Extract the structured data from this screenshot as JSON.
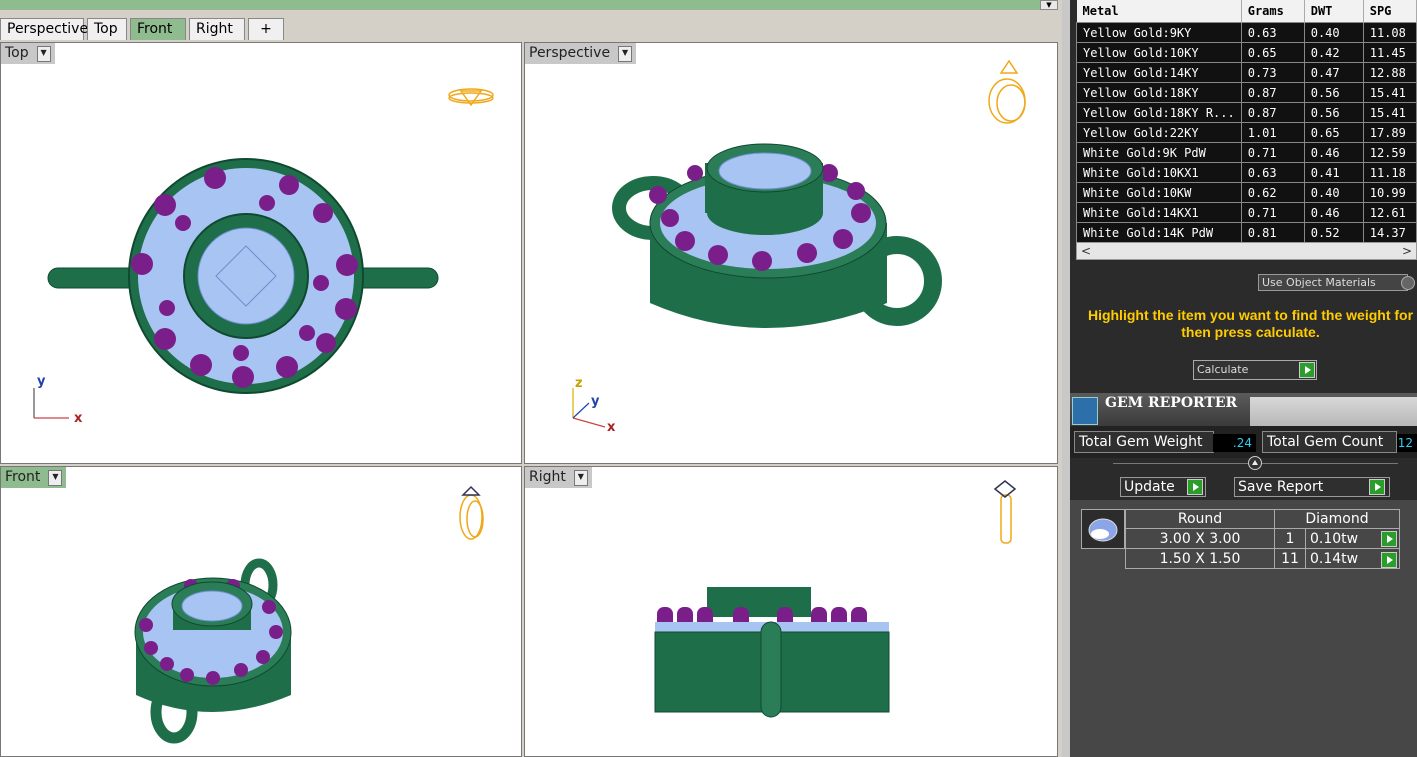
{
  "viewport_tabs": [
    {
      "label": "Perspective",
      "active": false
    },
    {
      "label": "Top",
      "active": false
    },
    {
      "label": "Front",
      "active": true
    },
    {
      "label": "Right",
      "active": false
    },
    {
      "label": "+",
      "active": false
    }
  ],
  "viewports": {
    "top": {
      "label": "Top",
      "axis_x": "x",
      "axis_y": "y"
    },
    "perspective": {
      "label": "Perspective",
      "axis_x": "x",
      "axis_y": "y",
      "axis_z": "z"
    },
    "front": {
      "label": "Front"
    },
    "right": {
      "label": "Right"
    }
  },
  "metal_table": {
    "headers": [
      "Metal",
      "Grams",
      "DWT",
      "SPG"
    ],
    "rows": [
      [
        "Yellow Gold:9KY",
        "0.63",
        "0.40",
        "11.08"
      ],
      [
        "Yellow Gold:10KY",
        "0.65",
        "0.42",
        "11.45"
      ],
      [
        "Yellow Gold:14KY",
        "0.73",
        "0.47",
        "12.88"
      ],
      [
        "Yellow Gold:18KY",
        "0.87",
        "0.56",
        "15.41"
      ],
      [
        "Yellow Gold:18KY R...",
        "0.87",
        "0.56",
        "15.41"
      ],
      [
        "Yellow Gold:22KY",
        "1.01",
        "0.65",
        "17.89"
      ],
      [
        "White Gold:9K PdW",
        "0.71",
        "0.46",
        "12.59"
      ],
      [
        "White Gold:10KX1",
        "0.63",
        "0.41",
        "11.18"
      ],
      [
        "White Gold:10KW",
        "0.62",
        "0.40",
        "10.99"
      ],
      [
        "White Gold:14KX1",
        "0.71",
        "0.46",
        "12.61"
      ],
      [
        "White Gold:14K PdW",
        "0.81",
        "0.52",
        "14.37"
      ]
    ]
  },
  "use_object_materials": "Use Object Materials",
  "hint_text": "Highlight the item you want to find the weight for then press calculate.",
  "calculate_label": "Calculate",
  "gem_reporter": {
    "title": "GEM REPORTER",
    "total_weight_label": "Total Gem Weight",
    "total_weight_value": ".24",
    "total_count_label": "Total Gem Count",
    "total_count_value": "12",
    "update_label": "Update",
    "save_report_label": "Save Report",
    "table_headers": [
      "Round",
      "Diamond"
    ],
    "rows": [
      {
        "size": "3.00 X 3.00",
        "count": "1",
        "weight": "0.10tw"
      },
      {
        "size": "1.50 X 1.50",
        "count": "11",
        "weight": "0.14tw"
      }
    ]
  },
  "colors": {
    "metal_green": "#1f6e4a",
    "stone_blue": "#a8c4f2",
    "gem_purple": "#7a1f8a",
    "active_tab": "#8fbc8f",
    "hint_yellow": "#ffcc00",
    "value_cyan": "#2ad2f0"
  }
}
